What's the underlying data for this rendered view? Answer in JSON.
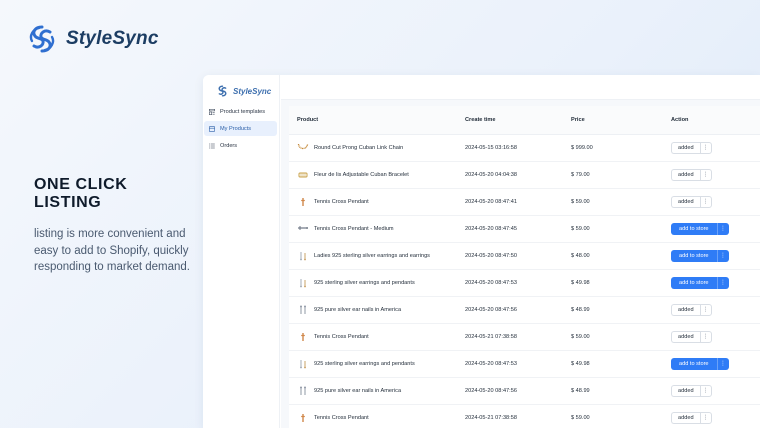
{
  "brand": {
    "name": "StyleSync",
    "color": "#2f6fd0"
  },
  "hero": {
    "title": "ONE CLICK LISTING",
    "description": "listing is more convenient and easy to add to Shopify, quickly responding to market demand."
  },
  "app": {
    "logo_text": "StyleSync",
    "nav": [
      {
        "label": "Product templates",
        "icon": "template-icon",
        "active": false
      },
      {
        "label": "My Products",
        "icon": "box-icon",
        "active": true
      },
      {
        "label": "Orders",
        "icon": "list-icon",
        "active": false
      }
    ],
    "table": {
      "headers": {
        "product": "Product",
        "time": "Create time",
        "price": "Price",
        "action": "Action"
      },
      "rows": [
        {
          "product": "Round Cut Prong Cuban Link Chain",
          "time": "2024-05-15 03:16:58",
          "price": "$ 999.00",
          "action": "added",
          "thumb": "chain"
        },
        {
          "product": "Fleur de lis Adjustable Cuban Bracelet",
          "time": "2024-05-20 04:04:38",
          "price": "$ 79.00",
          "action": "added",
          "thumb": "bracelet"
        },
        {
          "product": "Tennis Cross Pendant",
          "time": "2024-05-20 08:47:41",
          "price": "$ 59.00",
          "action": "added",
          "thumb": "pendant"
        },
        {
          "product": "Tennis Cross Pendant - Medium",
          "time": "2024-05-20 08:47:45",
          "price": "$ 59.00",
          "action": "add to store",
          "thumb": "pendant-medium"
        },
        {
          "product": "Ladies 925 sterling silver earrings and earrings",
          "time": "2024-05-20 08:47:50",
          "price": "$ 48.00",
          "action": "add to store",
          "thumb": "earrings"
        },
        {
          "product": "925 sterling silver earrings and pendants",
          "time": "2024-05-20 08:47:53",
          "price": "$ 49.98",
          "action": "add to store",
          "thumb": "earrings"
        },
        {
          "product": "925 pure silver ear nails in America",
          "time": "2024-05-20 08:47:56",
          "price": "$ 48.99",
          "action": "added",
          "thumb": "ear-nails"
        },
        {
          "product": "Tennis Cross Pendant",
          "time": "2024-05-21 07:38:58",
          "price": "$ 59.00",
          "action": "added",
          "thumb": "pendant"
        },
        {
          "product": "925 sterling silver earrings and pendants",
          "time": "2024-05-20 08:47:53",
          "price": "$ 49.98",
          "action": "add to store",
          "thumb": "earrings"
        },
        {
          "product": "925 pure silver ear nails in America",
          "time": "2024-05-20 08:47:56",
          "price": "$ 48.99",
          "action": "added",
          "thumb": "ear-nails"
        },
        {
          "product": "Tennis Cross Pendant",
          "time": "2024-05-21 07:38:58",
          "price": "$ 59.00",
          "action": "added",
          "thumb": "pendant"
        }
      ]
    },
    "more_glyph": "⋮",
    "colors": {
      "primary_button": "#2f7cf6",
      "active_nav": "#e8f0fd"
    }
  }
}
